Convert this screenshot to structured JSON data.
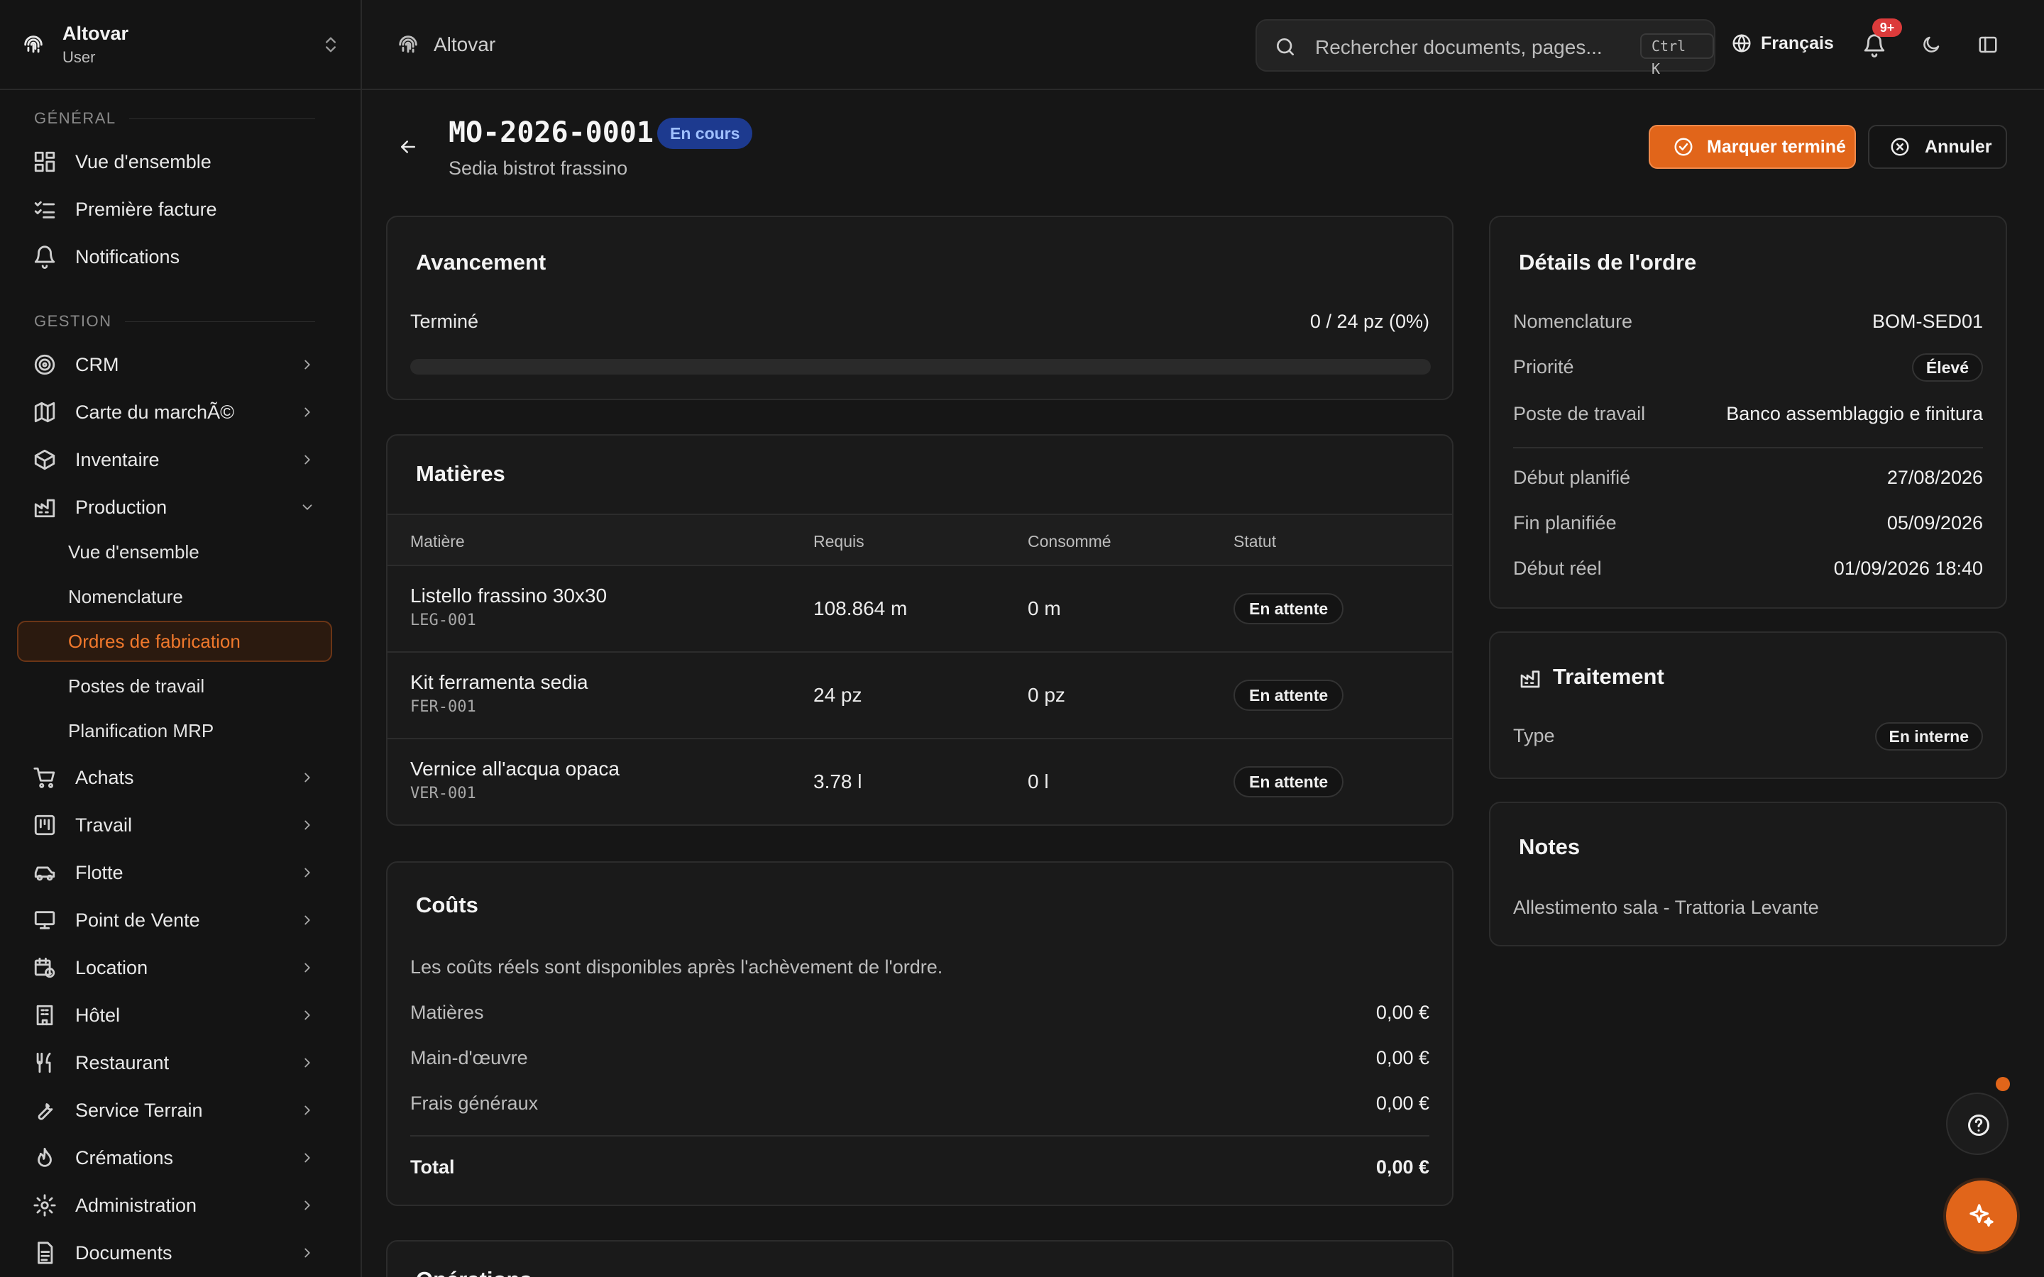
{
  "brand": {
    "name": "Altovar",
    "role": "User"
  },
  "sidebar": {
    "section_general": "GÉNÉRAL",
    "general_items": [
      {
        "label": "Vue d'ensemble",
        "icon": "dashboard-icon"
      },
      {
        "label": "Première facture",
        "icon": "checklist-icon"
      },
      {
        "label": "Notifications",
        "icon": "bell-icon"
      }
    ],
    "section_gestion": "GESTION",
    "gestion_items": [
      {
        "label": "CRM",
        "icon": "target-icon"
      },
      {
        "label": "Carte du marchÃ©",
        "icon": "map-icon"
      },
      {
        "label": "Inventaire",
        "icon": "box-icon"
      },
      {
        "label": "Production",
        "icon": "factory-icon"
      },
      {
        "label": "Achats",
        "icon": "cart-icon"
      },
      {
        "label": "Travail",
        "icon": "kanban-icon"
      },
      {
        "label": "Flotte",
        "icon": "car-icon"
      },
      {
        "label": "Point de Vente",
        "icon": "monitor-icon"
      },
      {
        "label": "Location",
        "icon": "calendar-clock-icon"
      },
      {
        "label": "Hôtel",
        "icon": "building-icon"
      },
      {
        "label": "Restaurant",
        "icon": "utensils-icon"
      },
      {
        "label": "Service Terrain",
        "icon": "wrench-icon"
      },
      {
        "label": "Crémations",
        "icon": "flame-icon"
      },
      {
        "label": "Administration",
        "icon": "gear-icon"
      },
      {
        "label": "Documents",
        "icon": "file-icon"
      }
    ],
    "production_sub": [
      "Vue d'ensemble",
      "Nomenclature",
      "Ordres de fabrication",
      "Postes de travail",
      "Planification MRP"
    ]
  },
  "topbar": {
    "breadcrumb": "Altovar",
    "search_placeholder": "Rechercher documents, pages...",
    "search_shortcut": "Ctrl K",
    "language": "Français",
    "notifications_badge": "9+"
  },
  "order": {
    "number": "MO-2026-0001",
    "status": "En cours",
    "product": "Sedia bistrot frassino",
    "btn_done": "Marquer terminé",
    "btn_cancel": "Annuler"
  },
  "progress": {
    "title": "Avancement",
    "label": "Terminé",
    "value_text": "0 / 24 pz (0%)",
    "fraction": 0
  },
  "materials": {
    "title": "Matières",
    "headers": {
      "material": "Matière",
      "required": "Requis",
      "consumed": "Consommé",
      "status": "Statut"
    },
    "rows": [
      {
        "name": "Listello frassino 30x30",
        "code": "LEG-001",
        "required": "108.864 m",
        "consumed": "0 m",
        "status": "En attente"
      },
      {
        "name": "Kit ferramenta sedia",
        "code": "FER-001",
        "required": "24 pz",
        "consumed": "0 pz",
        "status": "En attente"
      },
      {
        "name": "Vernice all'acqua opaca",
        "code": "VER-001",
        "required": "3.78 l",
        "consumed": "0 l",
        "status": "En attente"
      }
    ]
  },
  "costs": {
    "title": "Coûts",
    "note": "Les coûts réels sont disponibles après l'achèvement de l'ordre.",
    "materials_label": "Matières",
    "materials_value": "0,00 €",
    "labour_label": "Main-d'œuvre",
    "labour_value": "0,00 €",
    "overhead_label": "Frais généraux",
    "overhead_value": "0,00 €",
    "total_label": "Total",
    "total_value": "0,00 €"
  },
  "next_section_title": "Opérations",
  "details": {
    "title": "Détails de l'ordre",
    "bom_label": "Nomenclature",
    "bom_value": "BOM-SED01",
    "priority_label": "Priorité",
    "priority_value": "Élevé",
    "workstation_label": "Poste de travail",
    "workstation_value": "Banco assemblaggio e finitura",
    "planned_start_label": "Début planifié",
    "planned_start_value": "27/08/2026",
    "planned_end_label": "Fin planifiée",
    "planned_end_value": "05/09/2026",
    "actual_start_label": "Début réel",
    "actual_start_value": "01/09/2026 18:40"
  },
  "processing": {
    "title": "Traitement",
    "type_label": "Type",
    "type_value": "En interne"
  },
  "notes": {
    "title": "Notes",
    "text": "Allestimento sala - Trattoria Levante"
  },
  "colors": {
    "accent": "#e1651a",
    "status_blue": "#1d3a8f",
    "background": "#161616"
  }
}
